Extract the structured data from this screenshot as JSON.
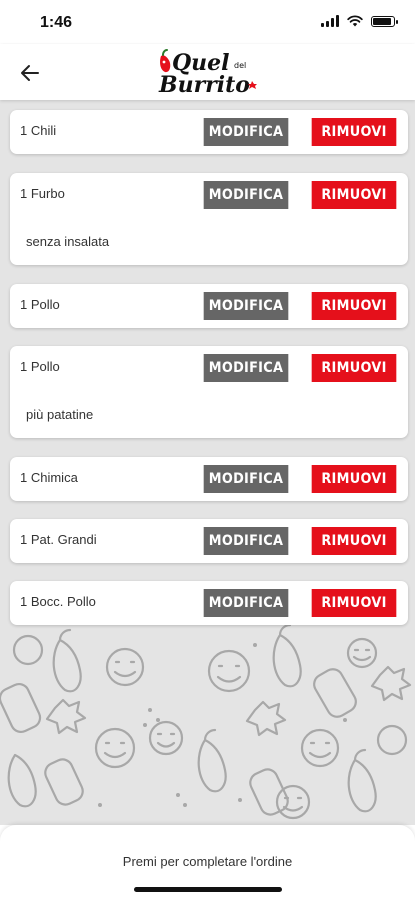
{
  "status_bar": {
    "time": "1:46"
  },
  "header": {
    "logo_text_top": "Quel",
    "logo_text_small": "del",
    "logo_text_bottom": "Burrito"
  },
  "buttons": {
    "edit_label": "MODIFICA",
    "remove_label": "RIMUOVI"
  },
  "cart_items": [
    {
      "name": "1 Chili",
      "note": ""
    },
    {
      "name": "1 Furbo",
      "note": "senza insalata"
    },
    {
      "name": "1 Pollo",
      "note": ""
    },
    {
      "name": "1 Pollo",
      "note": "più patatine"
    },
    {
      "name": "1 Chimica",
      "note": ""
    },
    {
      "name": "1 Pat. Grandi",
      "note": ""
    },
    {
      "name": "1 Bocc. Pollo",
      "note": ""
    }
  ],
  "footer": {
    "label": "Premi per completare l'ordine"
  },
  "colors": {
    "brand_red": "#e5101b",
    "edit_gray": "#666666",
    "background": "#e4e4e4"
  }
}
